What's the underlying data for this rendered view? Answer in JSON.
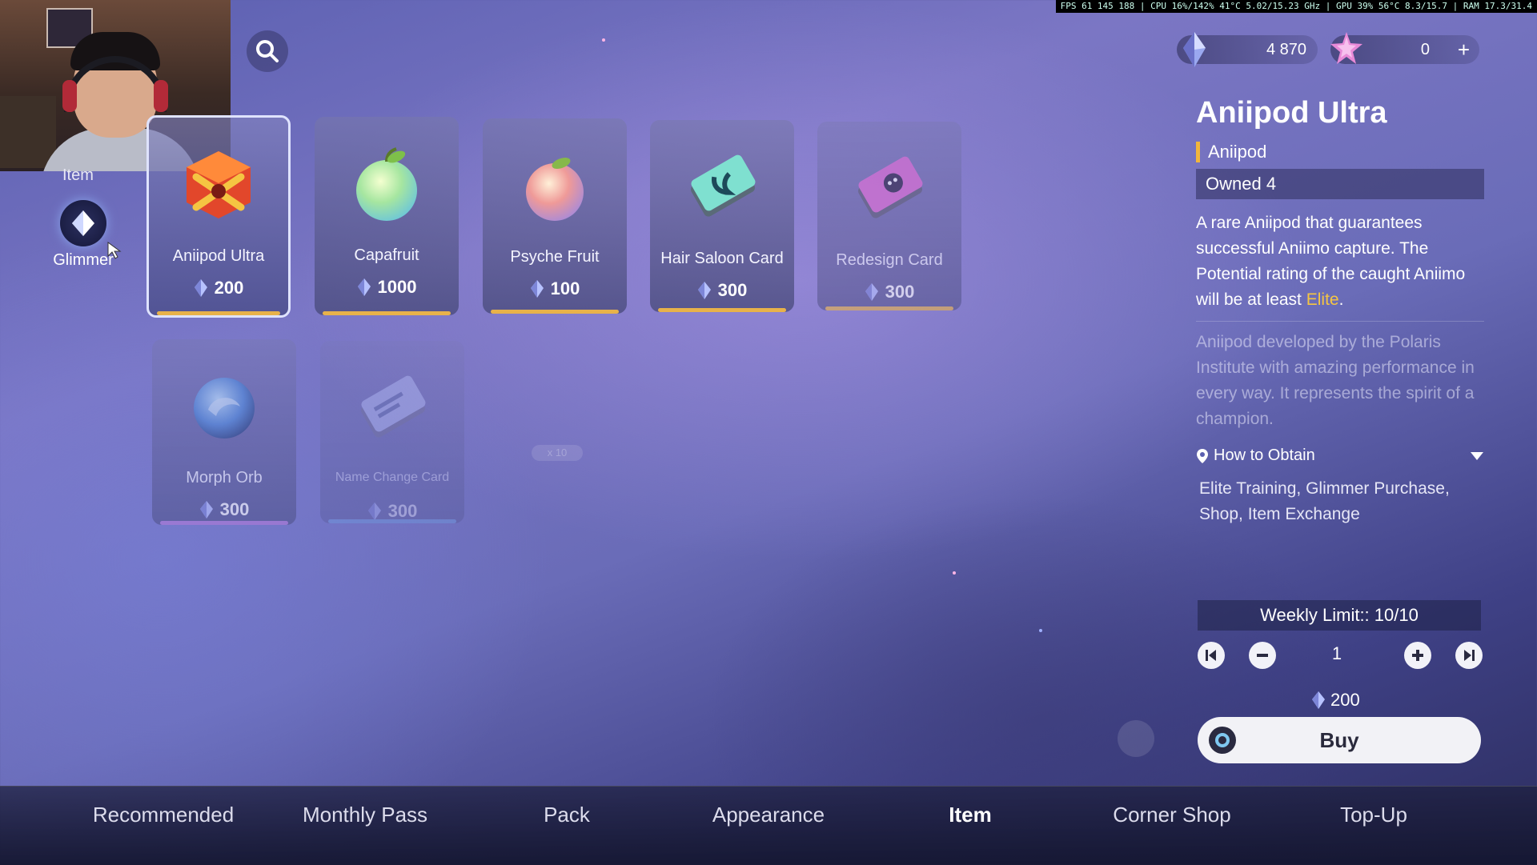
{
  "perf_overlay": "FPS 61 145 188 | CPU 16%/142% 41°C 5.02/15.23 GHz | GPU 39% 56°C 8.3/15.7 | RAM 17.3/31.4",
  "side_nav": {
    "partial_label": "Item",
    "glimmer_label": "Glimmer"
  },
  "currency": {
    "glimmer_amount": "4 870",
    "star_amount": "0",
    "add_label": "+"
  },
  "items": [
    {
      "name": "Aniipod Ultra",
      "price": "200",
      "state": "selected"
    },
    {
      "name": "Capafruit",
      "price": "1000",
      "state": "normal"
    },
    {
      "name": "Psyche Fruit",
      "price": "100",
      "state": "normal"
    },
    {
      "name": "Hair Saloon Card",
      "price": "300",
      "state": "normal"
    },
    {
      "name": "Redesign Card",
      "price": "300",
      "state": "dim"
    },
    {
      "name": "Morph Orb",
      "price": "300",
      "state": "dim"
    },
    {
      "name": "Name Change Card",
      "price": "300",
      "state": "faint"
    }
  ],
  "ghost_text": "x 10",
  "detail": {
    "title": "Aniipod Ultra",
    "category": "Aniipod",
    "owned": "Owned 4",
    "desc_before": "A rare Aniipod that guarantees successful Aniimo capture. The Potential rating of the caught Aniimo will be at least ",
    "desc_highlight": "Elite",
    "desc_after": ".",
    "lore": "Aniipod developed by the Polaris Institute with amazing performance in every way. It represents the spirit of a champion.",
    "obtain_heading": "How to Obtain",
    "obtain_text": "Elite Training, Glimmer Purchase, Shop, Item Exchange",
    "weekly_limit": "Weekly Limit:: 10/10",
    "quantity": "1",
    "total_cost": "200",
    "buy_label": "Buy"
  },
  "tabs": [
    "Recommended",
    "Monthly Pass",
    "Pack",
    "Appearance",
    "Item",
    "Corner Shop",
    "Top-Up"
  ],
  "active_tab": "Item",
  "colors": {
    "accent_gold": "#f5c542",
    "bar_gold": "#e8b24a",
    "bar_purple": "#b07ad8",
    "bar_blue": "#6ea8e8"
  }
}
